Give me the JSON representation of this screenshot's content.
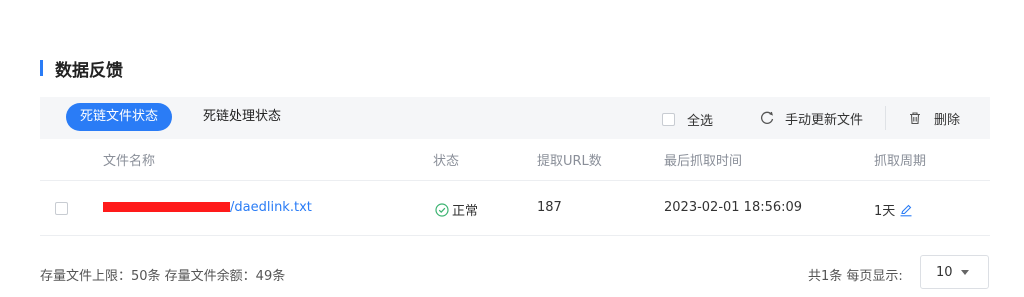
{
  "section": {
    "title": "数据反馈"
  },
  "tabs": [
    {
      "label": "死链文件状态",
      "active": true
    },
    {
      "label": "死链处理状态",
      "active": false
    }
  ],
  "toolbar": {
    "select_all": "全选",
    "refresh": "手动更新文件",
    "delete": "删除"
  },
  "table": {
    "columns": [
      "文件名称",
      "状态",
      "提取URL数",
      "最后抓取时间",
      "抓取周期"
    ],
    "rows": [
      {
        "filename_suffix": "/daedlink.txt",
        "status": "正常",
        "url_count": "187",
        "last_crawl": "2023-02-01 18:56:09",
        "period": "1天"
      }
    ]
  },
  "footer": {
    "quota": "存量文件上限：50条  存量文件余额：49条",
    "total": "共1条  每页显示:",
    "page_size": "10"
  },
  "colors": {
    "accent": "#2a7cf6",
    "success": "#3cb371",
    "redaction": "#ff1a1a"
  }
}
